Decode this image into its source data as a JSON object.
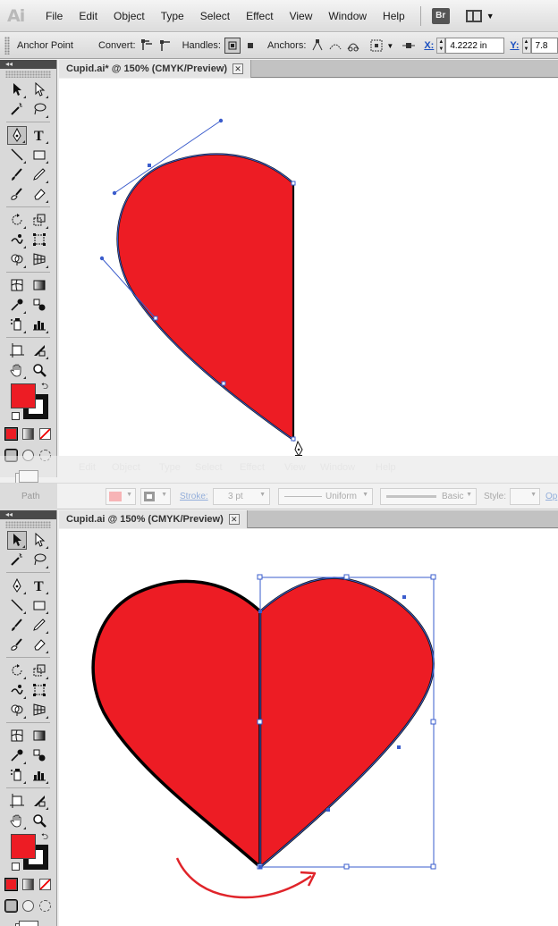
{
  "menubar": {
    "app_logo": "Ai",
    "items": [
      "File",
      "Edit",
      "Object",
      "Type",
      "Select",
      "Effect",
      "View",
      "Window",
      "Help"
    ],
    "bridge_button": "Br",
    "workspace_icon": "workspace-layout-icon"
  },
  "controlbar": {
    "anchor_point_label": "Anchor Point",
    "convert_label": "Convert:",
    "handles_label": "Handles:",
    "anchors_label": "Anchors:",
    "x_label": "X:",
    "x_value": "4.2222 in",
    "y_label": "Y:",
    "y_value": "7.8"
  },
  "doc1": {
    "tab_title": "Cupid.ai* @ 150% (CMYK/Preview)",
    "close_glyph": "✕"
  },
  "doc2": {
    "tab_title": "Cupid.ai @ 150% (CMYK/Preview)",
    "close_glyph": "✕"
  },
  "ghost_menu": [
    "Edit",
    "Object",
    "Type",
    "Select",
    "Effect",
    "View",
    "Window",
    "Help"
  ],
  "control2": {
    "path_label": "Path",
    "stroke_label": "Stroke:",
    "stroke_weight": "3 pt",
    "profile_label": "Uniform",
    "brush_label": "Basic",
    "style_label": "Style:",
    "opacity_link": "Op"
  },
  "colors": {
    "fill": "#ed1c24",
    "stroke": "#000000",
    "path_highlight": "#3a5ccc",
    "arrow": "#e0242a"
  },
  "tools": [
    "selection-tool",
    "direct-selection-tool",
    "magic-wand-tool",
    "lasso-tool",
    "pen-tool",
    "type-tool",
    "line-segment-tool",
    "rectangle-tool",
    "paintbrush-tool",
    "pencil-tool",
    "blob-brush-tool",
    "eraser-tool",
    "rotate-tool",
    "scale-tool",
    "warp-tool",
    "free-transform-tool",
    "shape-builder-tool",
    "perspective-grid-tool",
    "mesh-tool",
    "gradient-tool",
    "eyedropper-tool",
    "blend-tool",
    "symbol-sprayer-tool",
    "column-graph-tool",
    "artboard-tool",
    "slice-tool",
    "hand-tool",
    "zoom-tool"
  ]
}
